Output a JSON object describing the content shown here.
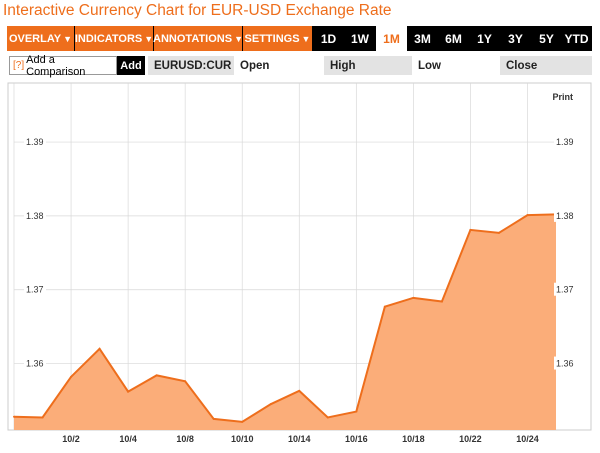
{
  "title": "Interactive Currency Chart for EUR-USD Exchange Rate",
  "toolbar": {
    "menus": [
      {
        "label": "OVERLAY",
        "caret": "▼"
      },
      {
        "label": "INDICATORS",
        "caret": "▼"
      },
      {
        "label": "ANNOTATIONS",
        "caret": "▼"
      },
      {
        "label": "SETTINGS",
        "caret": "▼"
      }
    ],
    "ranges": [
      "1D",
      "1W",
      "1M",
      "3M",
      "6M",
      "1Y",
      "3Y",
      "5Y",
      "YTD"
    ],
    "active_range": "1M"
  },
  "compare": {
    "help": "[?]",
    "label": "Add a Comparison",
    "add_label": "Add"
  },
  "quote": {
    "symbol": "EURUSD:CUR",
    "open_label": "Open",
    "high_label": "High",
    "low_label": "Low",
    "close_label": "Close"
  },
  "print_label": "Print",
  "colors": {
    "accent": "#ee6e1c",
    "area_fill": "#fbad79",
    "grid": "#d8d8d8"
  },
  "chart_data": {
    "type": "area",
    "x": [
      "9/30",
      "10/1",
      "10/2",
      "10/3",
      "10/4",
      "10/7",
      "10/8",
      "10/9",
      "10/10",
      "10/11",
      "10/14",
      "10/15",
      "10/16",
      "10/17",
      "10/18",
      "10/21",
      "10/22",
      "10/23",
      "10/24",
      "10/25"
    ],
    "values": [
      1.3528,
      1.3527,
      1.3582,
      1.362,
      1.3562,
      1.3584,
      1.3576,
      1.3525,
      1.3521,
      1.3545,
      1.3563,
      1.3527,
      1.3535,
      1.3677,
      1.3689,
      1.3684,
      1.3781,
      1.3777,
      1.3801,
      1.3802
    ],
    "x_tick_labels": [
      "10/2",
      "10/4",
      "10/8",
      "10/10",
      "10/14",
      "10/16",
      "10/18",
      "10/22",
      "10/24"
    ],
    "y_ticks": [
      1.36,
      1.37,
      1.38,
      1.39
    ],
    "y_tick_labels": [
      "1.36",
      "1.37",
      "1.38",
      "1.39"
    ],
    "ylim": [
      1.351,
      1.398
    ],
    "grid": true
  }
}
